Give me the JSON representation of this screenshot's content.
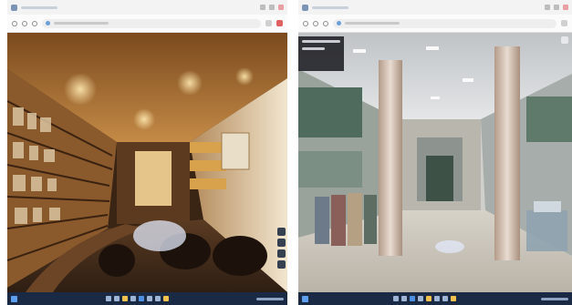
{
  "panes": [
    {
      "id": "left",
      "tab_title": "",
      "url": "",
      "scene": "shop-interior-panorama"
    },
    {
      "id": "right",
      "tab_title": "",
      "url": "",
      "scene": "building-lobby-panorama",
      "info_panel": {
        "title": "",
        "subtitle": ""
      }
    }
  ],
  "icons": {
    "back": "back-arrow-icon",
    "forward": "forward-arrow-icon",
    "reload": "reload-icon",
    "site": "site-favicon",
    "extension": "extension-icon",
    "minimize": "minimize-icon",
    "maximize": "maximize-icon",
    "close": "close-icon",
    "fullscreen": "fullscreen-icon",
    "zoom_in": "zoom-in-icon",
    "zoom_out": "zoom-out-icon",
    "compass": "compass-icon",
    "start": "start-menu-icon"
  },
  "colors": {
    "taskbar": "#1a2a44",
    "browser_chrome": "#f3f3f3",
    "floor_marker": "#e1e8fa",
    "accent": "#f2c14e"
  }
}
